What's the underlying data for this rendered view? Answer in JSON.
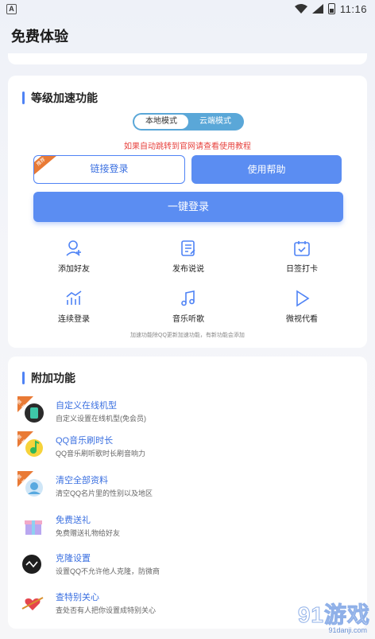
{
  "status_bar": {
    "app_letter": "A",
    "time": "11:16"
  },
  "page": {
    "title": "免费体验"
  },
  "speed_section": {
    "title": "等级加速功能",
    "modes": [
      "本地模式",
      "云端模式"
    ],
    "active_mode": "本地模式",
    "notice": "如果自动跳转到官网请查看使用教程",
    "login_link_label": "链接登录",
    "login_ribbon": "推荐",
    "help_label": "使用帮助",
    "one_click_label": "一键登录",
    "grid": [
      {
        "label": "添加好友",
        "icon": "add-friend-icon"
      },
      {
        "label": "发布说说",
        "icon": "post-status-icon"
      },
      {
        "label": "日签打卡",
        "icon": "daily-checkin-icon"
      },
      {
        "label": "连续登录",
        "icon": "continuous-login-icon"
      },
      {
        "label": "音乐听歌",
        "icon": "music-icon"
      },
      {
        "label": "微视代看",
        "icon": "video-play-icon"
      }
    ],
    "footer_note": "加速功能除QQ更新加速功能，有新功能会添加"
  },
  "extra_section": {
    "title": "附加功能",
    "items": [
      {
        "title": "自定义在线机型",
        "subtitle": "自定义设置在线机型(免会员)",
        "icon": "phone-model-icon",
        "badge": true
      },
      {
        "title": "QQ音乐刷时长",
        "subtitle": "QQ音乐刷听歌时长刷音响力",
        "icon": "qq-music-icon",
        "badge": true
      },
      {
        "title": "清空全部资料",
        "subtitle": "清空QQ名片里的性别以及地区",
        "icon": "clear-profile-icon",
        "badge": true
      },
      {
        "title": "免费送礼",
        "subtitle": "免费赠送礼物给好友",
        "icon": "gift-icon",
        "badge": false
      },
      {
        "title": "克隆设置",
        "subtitle": "设置QQ不允许他人克隆，防微商",
        "icon": "clone-icon",
        "badge": false
      },
      {
        "title": "查特别关心",
        "subtitle": "查处否有人把你设置成特别关心",
        "icon": "heart-arrow-icon",
        "badge": false
      }
    ],
    "badge_text": "推荐"
  },
  "watermark": {
    "main": "91游戏",
    "sub": "91danji.com"
  },
  "colors": {
    "accent": "#5b8df2",
    "warn": "#e7433f",
    "badge": "#e97a35",
    "toggle": "#5aa7d8"
  }
}
